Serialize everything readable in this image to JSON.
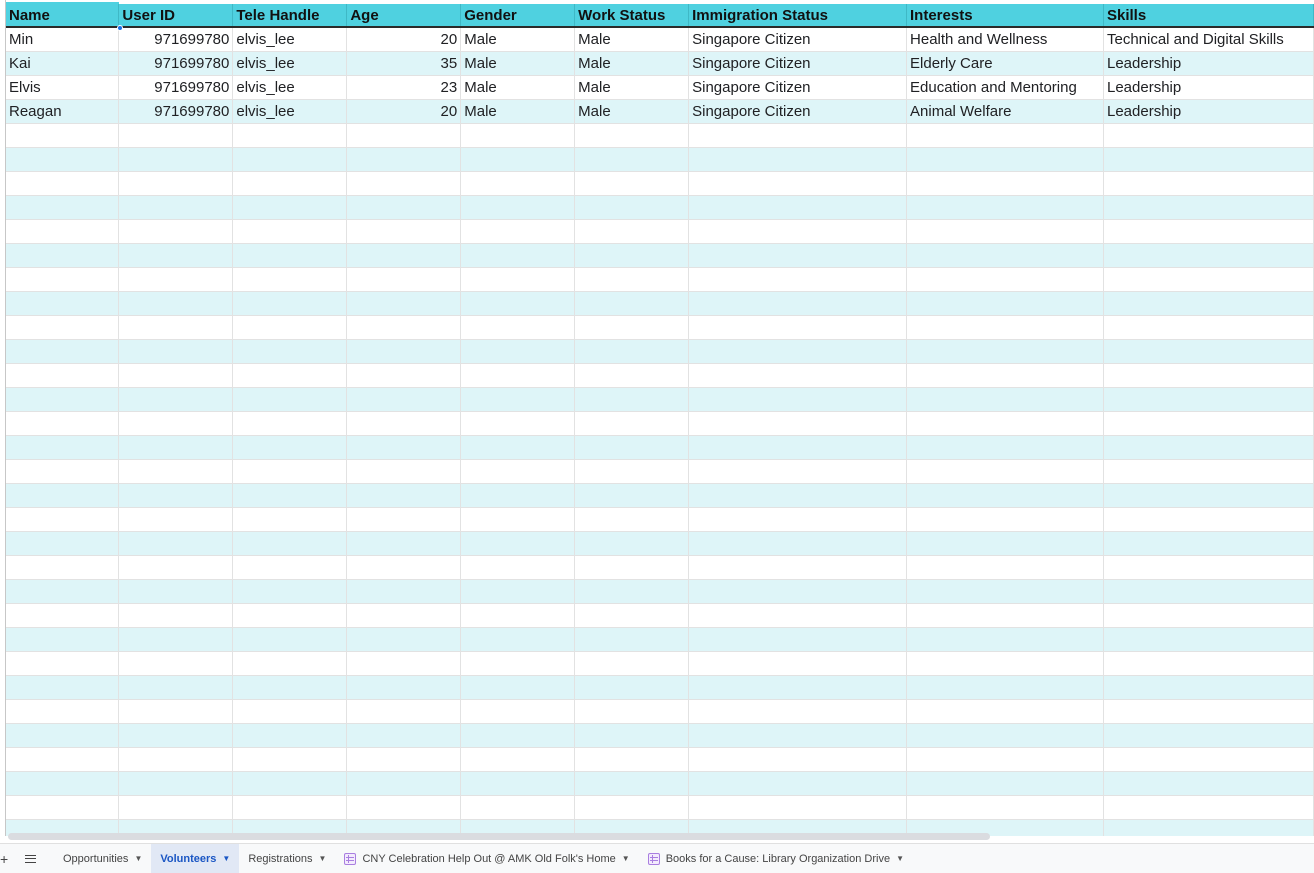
{
  "columns": [
    "Name",
    "User ID",
    "Tele Handle",
    "Age",
    "Gender",
    "Work Status",
    "Immigration Status",
    "Interests",
    "Skills"
  ],
  "rows": [
    [
      "Min",
      "971699780",
      "elvis_lee",
      "20",
      "Male",
      "Male",
      "Singapore Citizen",
      "Health and Wellness",
      "Technical and Digital Skills"
    ],
    [
      "Kai",
      "971699780",
      "elvis_lee",
      "35",
      "Male",
      "Male",
      "Singapore Citizen",
      "Elderly Care",
      "Leadership"
    ],
    [
      "Elvis",
      "971699780",
      "elvis_lee",
      "23",
      "Male",
      "Male",
      "Singapore Citizen",
      "Education and Mentoring",
      "Leadership"
    ],
    [
      "Reagan",
      "971699780",
      "elvis_lee",
      "20",
      "Male",
      "Male",
      "Singapore Citizen",
      "Animal Welfare",
      "Leadership"
    ]
  ],
  "sheet_tabs": [
    {
      "label": "Opportunities",
      "active": false,
      "icon": ""
    },
    {
      "label": "Volunteers",
      "active": true,
      "icon": ""
    },
    {
      "label": "Registrations",
      "active": false,
      "icon": ""
    },
    {
      "label": "CNY Celebration Help Out @ AMK Old Folk's Home",
      "active": false,
      "icon": "sheet-icon"
    },
    {
      "label": "Books for a Cause: Library Organization Drive",
      "active": false,
      "icon": "sheet-icon"
    }
  ],
  "colors": {
    "header_bg": "#4fd1e0",
    "band_bg": "#def5f8",
    "active_tab_text": "#1a56c4"
  }
}
